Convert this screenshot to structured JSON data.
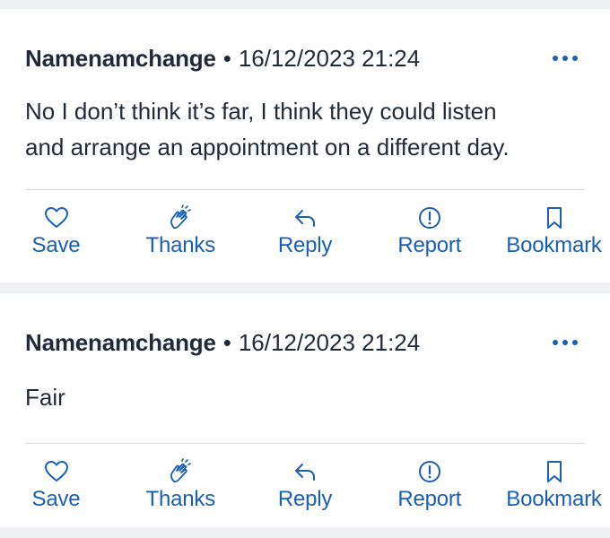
{
  "colors": {
    "accent": "#1a5fb4",
    "text": "#1f2a3a",
    "background": "#eef0f3",
    "card": "#ffffff"
  },
  "posts": [
    {
      "author": "Namenamchange",
      "separator": "•",
      "timestamp": "16/12/2023 21:24",
      "body_lines": [
        "No I don’t think it’s far, I think they could listen",
        "and arrange an appointment on a different day."
      ],
      "actions": [
        {
          "label": "Save",
          "icon": "heart-icon"
        },
        {
          "label": "Thanks",
          "icon": "clapping-hands-icon"
        },
        {
          "label": "Reply",
          "icon": "reply-arrow-icon"
        },
        {
          "label": "Report",
          "icon": "exclamation-circle-icon"
        },
        {
          "label": "Bookmark",
          "icon": "bookmark-icon"
        }
      ]
    },
    {
      "author": "Namenamchange",
      "separator": "•",
      "timestamp": "16/12/2023 21:24",
      "body_lines": [
        "Fair"
      ],
      "actions": [
        {
          "label": "Save",
          "icon": "heart-icon"
        },
        {
          "label": "Thanks",
          "icon": "clapping-hands-icon"
        },
        {
          "label": "Reply",
          "icon": "reply-arrow-icon"
        },
        {
          "label": "Report",
          "icon": "exclamation-circle-icon"
        },
        {
          "label": "Bookmark",
          "icon": "bookmark-icon"
        }
      ]
    }
  ]
}
